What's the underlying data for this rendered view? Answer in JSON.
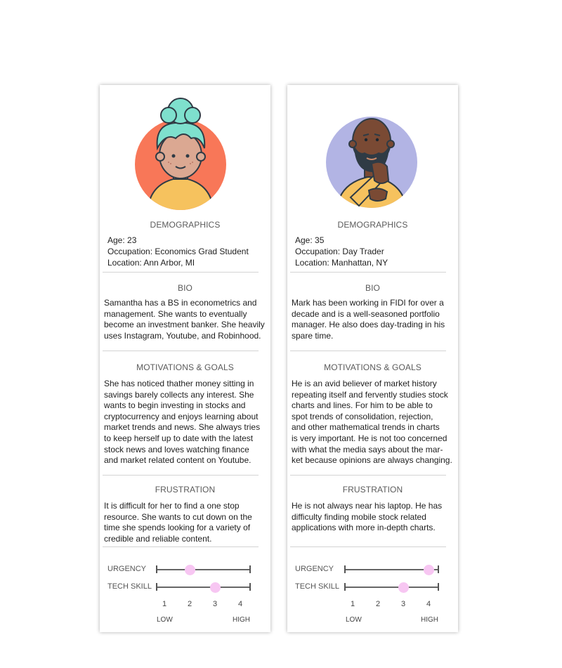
{
  "colors": {
    "card_bg": "#ffffff",
    "persona1_circle": "#f87758",
    "persona2_circle": "#b2b4e4",
    "slider_knob": "#f7c6f2"
  },
  "personas": [
    {
      "avatar_icon": "woman-teal-hair-avatar-icon",
      "demographics": {
        "heading": "DEMOGRAPHICS",
        "age": "Age: 23",
        "occupation": "Occupation: Economics Grad Student",
        "location": "Location:  Ann Arbor, MI"
      },
      "bio": {
        "heading": "BIO",
        "lines": [
          "Samantha has a BS in econometrics and",
          "management. She wants to eventually",
          "become an investment banker. She heavily",
          "uses Instagram, Youtube, and Robinhood."
        ]
      },
      "motivations": {
        "heading": "MOTIVATIONS & GOALS",
        "lines": [
          "She has noticed thather money sitting in",
          "savings barely collects any interest. She",
          "wants to begin investing in stocks and",
          "cryptocurrency and enjoys learning about",
          "market trends and news. She always tries",
          "to keep herself up to date with the latest",
          "stock news and loves watching finance",
          "and market related content on Youtube."
        ]
      },
      "frustration": {
        "heading": "FRUSTRATION",
        "lines": [
          "It is difficult for her to find a one stop",
          "resource. She wants to cut down on the",
          "time she spends looking for a variety of",
          "credible and reliable content."
        ]
      },
      "scales": {
        "urgency_label": "URGENCY",
        "tech_label": "TECH SKILL",
        "urgency_value": 2,
        "tech_value": 3,
        "ticks": [
          "1",
          "2",
          "3",
          "4"
        ],
        "low": "LOW",
        "high": "HIGH"
      }
    },
    {
      "avatar_icon": "bearded-man-avatar-icon",
      "demographics": {
        "heading": "DEMOGRAPHICS",
        "age": "Age: 35",
        "occupation": "Occupation:  Day Trader",
        "location": "Location:  Manhattan, NY"
      },
      "bio": {
        "heading": "BIO",
        "lines": [
          "Mark has been working in FIDI for over a",
          "decade and is a well-seasoned portfolio",
          "manager. He also does day-trading in his",
          "spare time."
        ]
      },
      "motivations": {
        "heading": "MOTIVATIONS & GOALS",
        "lines": [
          "He is an avid believer of market history",
          "repeating itself and fervently studies stock",
          "charts and lines. For him to be able to",
          "spot trends of consolidation, rejection,",
          "and other mathematical trends in charts",
          "is very important. He is not too concerned",
          "with what the media says about the mar-",
          "ket because opinions are always changing."
        ]
      },
      "frustration": {
        "heading": "FRUSTRATION",
        "lines": [
          "He is not always near his laptop. He has",
          "difficulty finding mobile stock related",
          "applications with more in-depth charts."
        ]
      },
      "scales": {
        "urgency_label": "URGENCY",
        "tech_label": "TECH SKILL",
        "urgency_value": 4,
        "tech_value": 3,
        "ticks": [
          "1",
          "2",
          "3",
          "4"
        ],
        "low": "LOW",
        "high": "HIGH"
      }
    }
  ]
}
